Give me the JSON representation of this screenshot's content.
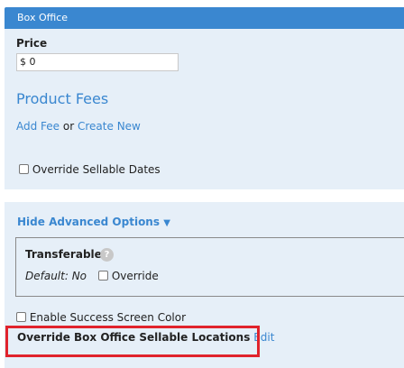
{
  "header": {
    "title": "Box Office"
  },
  "price": {
    "label": "Price",
    "value": "$ 0"
  },
  "fees": {
    "heading": "Product Fees",
    "add_fee": "Add Fee",
    "or_text": "or",
    "create_new": "Create New"
  },
  "override_dates": {
    "label": "Override Sellable Dates",
    "checked": false
  },
  "advanced": {
    "toggle_label": "Hide Advanced Options",
    "caret": "▼",
    "transferable": {
      "label": "Transferable",
      "help_icon": "?",
      "default_text": "Default: No",
      "override_label": "Override",
      "override_checked": false
    },
    "success_color": {
      "label": "Enable Success Screen Color",
      "checked": false
    },
    "locations": {
      "label": "Override Box Office Sellable Locations",
      "edit_link": "Edit"
    }
  },
  "colors": {
    "accent": "#3a87d0",
    "panel_bg": "#e6eff8",
    "highlight": "#e0232c"
  }
}
